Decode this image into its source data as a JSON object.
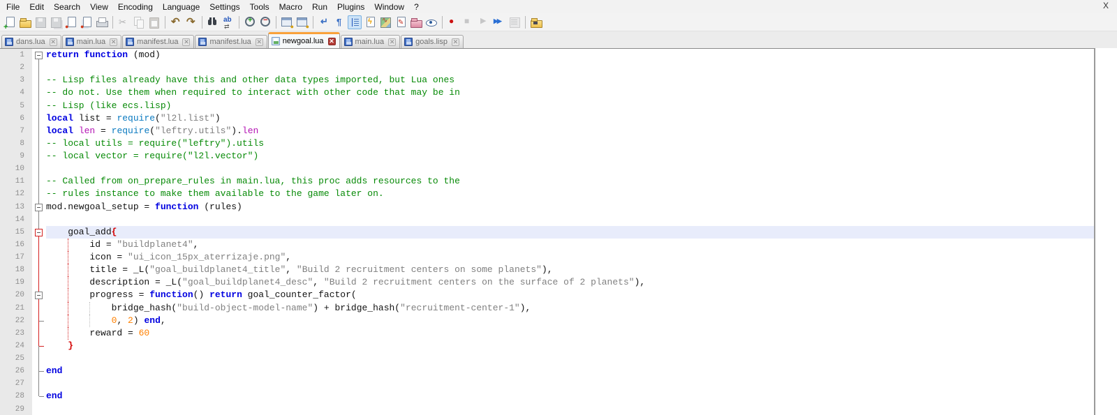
{
  "window": {
    "close_label": "X"
  },
  "menu": {
    "items": [
      "File",
      "Edit",
      "Search",
      "View",
      "Encoding",
      "Language",
      "Settings",
      "Tools",
      "Macro",
      "Run",
      "Plugins",
      "Window",
      "?"
    ]
  },
  "toolbar": {
    "icons": [
      {
        "k": "new",
        "name": "new-file-icon"
      },
      {
        "k": "open",
        "name": "open-file-icon"
      },
      {
        "k": "save",
        "name": "save-icon",
        "disabled": true
      },
      {
        "k": "saveall",
        "name": "save-all-icon",
        "disabled": true
      },
      {
        "k": "close",
        "name": "close-file-icon"
      },
      {
        "k": "closeall",
        "name": "close-all-files-icon"
      },
      {
        "k": "print",
        "name": "print-icon"
      },
      {
        "k": "sep"
      },
      {
        "k": "cut",
        "name": "cut-icon",
        "disabled": true
      },
      {
        "k": "copy",
        "name": "copy-icon",
        "disabled": true
      },
      {
        "k": "paste",
        "name": "paste-icon",
        "disabled": true
      },
      {
        "k": "sep"
      },
      {
        "k": "undo",
        "name": "undo-icon"
      },
      {
        "k": "redo",
        "name": "redo-icon"
      },
      {
        "k": "sep"
      },
      {
        "k": "find",
        "name": "find-icon"
      },
      {
        "k": "replace",
        "name": "replace-icon"
      },
      {
        "k": "sep"
      },
      {
        "k": "zoomin",
        "name": "zoom-in-icon"
      },
      {
        "k": "zoomout",
        "name": "zoom-out-icon"
      },
      {
        "k": "sep"
      },
      {
        "k": "syncv",
        "name": "sync-vertical-scroll-icon"
      },
      {
        "k": "synch",
        "name": "sync-horizontal-scroll-icon"
      },
      {
        "k": "sep"
      },
      {
        "k": "wrap",
        "name": "word-wrap-icon"
      },
      {
        "k": "pilcrow",
        "name": "show-all-characters-icon"
      },
      {
        "k": "indent",
        "name": "show-indent-guide-icon",
        "active": true
      },
      {
        "k": "funclist",
        "name": "function-list-icon"
      },
      {
        "k": "docmap",
        "name": "document-map-icon"
      },
      {
        "k": "docpen",
        "name": "document-edit-icon"
      },
      {
        "k": "workspace",
        "name": "folder-as-workspace-icon"
      },
      {
        "k": "monitor",
        "name": "monitoring-eye-icon"
      },
      {
        "k": "sep"
      },
      {
        "k": "record",
        "name": "macro-record-icon"
      },
      {
        "k": "stop",
        "name": "macro-stop-icon",
        "disabled": true
      },
      {
        "k": "play",
        "name": "macro-playback-icon",
        "disabled": true
      },
      {
        "k": "playmulti",
        "name": "macro-run-multiple-icon"
      },
      {
        "k": "macrosave",
        "name": "macro-save-icon",
        "disabled": true
      },
      {
        "k": "sep"
      },
      {
        "k": "pluginfolder",
        "name": "plugin-folder-icon"
      }
    ]
  },
  "tabs": [
    {
      "label": "dans.lua"
    },
    {
      "label": "main.lua"
    },
    {
      "label": "manifest.lua"
    },
    {
      "label": "manifest.lua"
    },
    {
      "label": "newgoal.lua",
      "active": true
    },
    {
      "label": "main.lua"
    },
    {
      "label": "goals.lisp"
    }
  ],
  "colors": {
    "keyword": "#0000e0",
    "basic_function": "#0b7ac0",
    "library_function": "#b414b4",
    "string": "#808080",
    "comment": "#078a07",
    "number": "#ff8000",
    "brace_match": "#d40000",
    "current_line_bg": "#e8ecfb",
    "active_tab_top": "#f9a13a",
    "fold_highlight": "#d42020"
  },
  "editor": {
    "lines": [
      {
        "n": 1,
        "fold": {
          "m": "box",
          "mc": "g",
          "d": "g"
        },
        "tokens": [
          [
            "k",
            "return"
          ],
          [
            "p",
            " "
          ],
          [
            "k",
            "function"
          ],
          [
            "p",
            " (mod)"
          ]
        ]
      },
      {
        "n": 2,
        "fold": {
          "u": "g",
          "d": "g"
        },
        "tokens": []
      },
      {
        "n": 3,
        "fold": {
          "u": "g",
          "d": "g"
        },
        "tokens": [
          [
            "c",
            "-- Lisp files already have this and other data types imported, but Lua ones"
          ]
        ]
      },
      {
        "n": 4,
        "fold": {
          "u": "g",
          "d": "g"
        },
        "tokens": [
          [
            "c",
            "-- do not. Use them when required to interact with other code that may be in"
          ]
        ]
      },
      {
        "n": 5,
        "fold": {
          "u": "g",
          "d": "g"
        },
        "tokens": [
          [
            "c",
            "-- Lisp (like ecs.lisp)"
          ]
        ]
      },
      {
        "n": 6,
        "fold": {
          "u": "g",
          "d": "g"
        },
        "tokens": [
          [
            "k",
            "local"
          ],
          [
            "p",
            " list = "
          ],
          [
            "f",
            "require"
          ],
          [
            "p",
            "("
          ],
          [
            "s",
            "\"l2l.list\""
          ],
          [
            "p",
            ")"
          ]
        ]
      },
      {
        "n": 7,
        "fold": {
          "u": "g",
          "d": "g"
        },
        "tokens": [
          [
            "k",
            "local"
          ],
          [
            "p",
            " "
          ],
          [
            "l",
            "len"
          ],
          [
            "p",
            " = "
          ],
          [
            "f",
            "require"
          ],
          [
            "p",
            "("
          ],
          [
            "s",
            "\"leftry.utils\""
          ],
          [
            "p",
            ")."
          ],
          [
            "l",
            "len"
          ]
        ]
      },
      {
        "n": 8,
        "fold": {
          "u": "g",
          "d": "g"
        },
        "tokens": [
          [
            "c",
            "-- local utils = require(\"leftry\").utils"
          ]
        ]
      },
      {
        "n": 9,
        "fold": {
          "u": "g",
          "d": "g"
        },
        "tokens": [
          [
            "c",
            "-- local vector = require(\"l2l.vector\")"
          ]
        ]
      },
      {
        "n": 10,
        "fold": {
          "u": "g",
          "d": "g"
        },
        "tokens": []
      },
      {
        "n": 11,
        "fold": {
          "u": "g",
          "d": "g"
        },
        "tokens": [
          [
            "c",
            "-- Called from on_prepare_rules in main.lua, this proc adds resources to the"
          ]
        ]
      },
      {
        "n": 12,
        "fold": {
          "u": "g",
          "d": "g"
        },
        "tokens": [
          [
            "c",
            "-- rules instance to make them available to the game later on."
          ]
        ]
      },
      {
        "n": 13,
        "fold": {
          "m": "box",
          "mc": "g",
          "u": "g",
          "d": "g"
        },
        "tokens": [
          [
            "p",
            "mod.newgoal_setup = "
          ],
          [
            "k",
            "function"
          ],
          [
            "p",
            " (rules)"
          ]
        ]
      },
      {
        "n": 14,
        "fold": {
          "u": "g",
          "d": "g"
        },
        "tokens": []
      },
      {
        "n": 15,
        "cur": true,
        "fold": {
          "m": "box",
          "mc": "r",
          "u": "g",
          "d": "r"
        },
        "tokens": [
          [
            "p",
            "    goal_add"
          ],
          [
            "b",
            "{"
          ]
        ]
      },
      {
        "n": 16,
        "fold": {
          "u": "r",
          "d": "r"
        },
        "guides": [
          [
            "r",
            4
          ]
        ],
        "tokens": [
          [
            "p",
            "        id = "
          ],
          [
            "s",
            "\"buildplanet4\""
          ],
          [
            "p",
            ","
          ]
        ]
      },
      {
        "n": 17,
        "fold": {
          "u": "r",
          "d": "r"
        },
        "guides": [
          [
            "r",
            4
          ]
        ],
        "tokens": [
          [
            "p",
            "        icon = "
          ],
          [
            "s",
            "\"ui_icon_15px_aterrizaje.png\""
          ],
          [
            "p",
            ","
          ]
        ]
      },
      {
        "n": 18,
        "fold": {
          "u": "r",
          "d": "r"
        },
        "guides": [
          [
            "r",
            4
          ]
        ],
        "tokens": [
          [
            "p",
            "        title = _L("
          ],
          [
            "s",
            "\"goal_buildplanet4_title\""
          ],
          [
            "p",
            ", "
          ],
          [
            "s",
            "\"Build 2 recruitment centers on some planets\""
          ],
          [
            "p",
            "),"
          ]
        ]
      },
      {
        "n": 19,
        "fold": {
          "u": "r",
          "d": "r"
        },
        "guides": [
          [
            "r",
            4
          ]
        ],
        "tokens": [
          [
            "p",
            "        description = _L("
          ],
          [
            "s",
            "\"goal_buildplanet4_desc\""
          ],
          [
            "p",
            ", "
          ],
          [
            "s",
            "\"Build 2 recruitment centers on the surface of 2 planets\""
          ],
          [
            "p",
            "),"
          ]
        ]
      },
      {
        "n": 20,
        "fold": {
          "m": "box",
          "mc": "g",
          "u": "r",
          "d": "r"
        },
        "guides": [
          [
            "r",
            4
          ]
        ],
        "tokens": [
          [
            "p",
            "        progress = "
          ],
          [
            "k",
            "function"
          ],
          [
            "p",
            "() "
          ],
          [
            "k",
            "return"
          ],
          [
            "p",
            " goal_counter_factor("
          ]
        ]
      },
      {
        "n": 21,
        "fold": {
          "u": "r",
          "d": "r"
        },
        "guides": [
          [
            "r",
            4
          ],
          [
            "g",
            8
          ]
        ],
        "tokens": [
          [
            "p",
            "            bridge_hash("
          ],
          [
            "s",
            "\"build-object-model-name\""
          ],
          [
            "p",
            ") + bridge_hash("
          ],
          [
            "s",
            "\"recruitment-center-1\""
          ],
          [
            "p",
            "),"
          ]
        ]
      },
      {
        "n": 22,
        "fold": {
          "u": "r",
          "d": "r",
          "m": "tick",
          "mc": "g"
        },
        "guides": [
          [
            "r",
            4
          ],
          [
            "g",
            8
          ]
        ],
        "tokens": [
          [
            "p",
            "            "
          ],
          [
            "n",
            "0"
          ],
          [
            "p",
            ", "
          ],
          [
            "n",
            "2"
          ],
          [
            "p",
            ") "
          ],
          [
            "k",
            "end"
          ],
          [
            "p",
            ","
          ]
        ]
      },
      {
        "n": 23,
        "fold": {
          "u": "r",
          "d": "r"
        },
        "guides": [
          [
            "r",
            4
          ]
        ],
        "tokens": [
          [
            "p",
            "        reward = "
          ],
          [
            "n",
            "60"
          ]
        ]
      },
      {
        "n": 24,
        "fold": {
          "u": "r",
          "d": "g",
          "m": "tick",
          "mc": "r"
        },
        "tokens": [
          [
            "p",
            "    "
          ],
          [
            "b",
            "}"
          ]
        ]
      },
      {
        "n": 25,
        "fold": {
          "u": "g",
          "d": "g"
        },
        "tokens": []
      },
      {
        "n": 26,
        "fold": {
          "u": "g",
          "d": "g",
          "m": "tick",
          "mc": "g"
        },
        "tokens": [
          [
            "k",
            "end"
          ]
        ]
      },
      {
        "n": 27,
        "fold": {
          "u": "g",
          "d": "g"
        },
        "tokens": []
      },
      {
        "n": 28,
        "fold": {
          "u": "g",
          "m": "tick",
          "mc": "g"
        },
        "tokens": [
          [
            "k",
            "end"
          ]
        ]
      },
      {
        "n": 29,
        "fold": {},
        "tokens": []
      }
    ]
  }
}
